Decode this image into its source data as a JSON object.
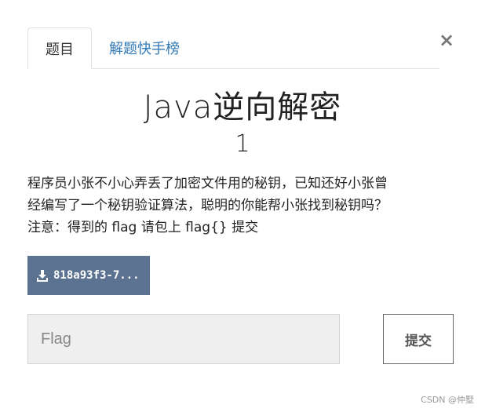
{
  "tabs": {
    "active": "题目",
    "other": "解题快手榜"
  },
  "close_symbol": "×",
  "challenge": {
    "title": "Java逆向解密",
    "points": "1",
    "description_line1": "程序员小张不小心弄丢了加密文件用的秘钥，已知还好小张曾",
    "description_line2": "经编写了一个秘钥验证算法，聪明的你能帮小张找到秘钥吗？",
    "description_line3": "注意：得到的 flag 请包上 flag{} 提交"
  },
  "download": {
    "label": "818a93f3-7...",
    "icon": "download-icon"
  },
  "flag_input": {
    "placeholder": "Flag",
    "value": ""
  },
  "submit_label": "提交",
  "watermark": "CSDN @仲墅",
  "colors": {
    "download_bg": "#5b7290",
    "link": "#337ab7",
    "input_bg": "#efefef"
  }
}
